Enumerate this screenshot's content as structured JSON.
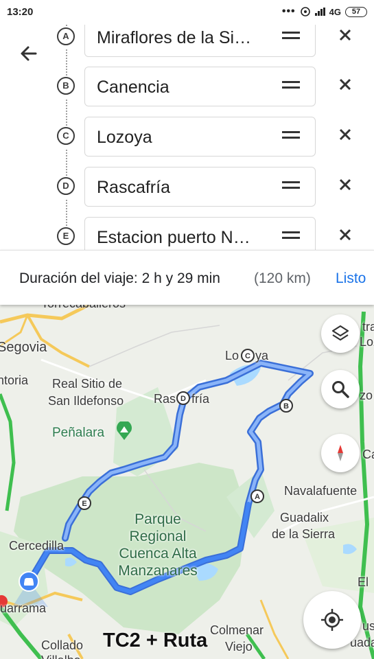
{
  "status_bar": {
    "time": "13:20",
    "network": "4G",
    "battery": "57"
  },
  "waypoints": [
    {
      "letter": "A",
      "value": "Miraflores de la Si…"
    },
    {
      "letter": "B",
      "value": "Canencia"
    },
    {
      "letter": "C",
      "value": "Lozoya"
    },
    {
      "letter": "D",
      "value": "Rascafría"
    },
    {
      "letter": "E",
      "value": "Estacion puerto N…"
    }
  ],
  "trip": {
    "duration_label": "Duración del viaje: 2 h y 29 min",
    "distance": "(120 km)",
    "done_label": "Listo"
  },
  "map": {
    "labels": {
      "torrecaballeros": "Torrecaballeros",
      "segovia": "Segovia",
      "ntoria": "ntoria",
      "real_sitio_1": "Real Sitio de",
      "real_sitio_2": "San Ildefonso",
      "penalara": "Peñalara",
      "lozoya_a": "Lo",
      "lozoya_b": "ya",
      "rascafria_a": "Ras",
      "rascafria_b": "fría",
      "navalafuente": "Navalafuente",
      "guadalix_1": "Guadalix",
      "guadalix_2": "de la Sierra",
      "parque_1": "Parque",
      "parque_2": "Regional",
      "parque_3": "Cuenca Alta",
      "parque_4": "Manzanares",
      "cercedilla": "Cercedilla",
      "guadarrama": "uarrama",
      "collado_1": "Collado",
      "collado_2": "Villalba",
      "colmenar_1": "Colmenar",
      "colmenar_2": "Viejo",
      "el": "El",
      "edge_tra": "tra",
      "edge_loz": "Loz",
      "edge_zo": "zo",
      "edge_ca": "Ca",
      "edge_us": "us",
      "edge_uada": "uada"
    },
    "caption": "TC2 + Ruta"
  },
  "icons": {
    "back": "arrow-left-icon",
    "drag": "drag-handle-icon",
    "remove": "close-icon",
    "layers": "layers-icon",
    "search": "search-icon",
    "compass": "compass-icon",
    "location": "my-location-icon",
    "car": "car-icon"
  },
  "colors": {
    "route": "#4285f4",
    "route_alt": "#8ab4f8",
    "link": "#1a73e8",
    "park_green": "#c8e6c9",
    "highway": "#f5c95a"
  }
}
